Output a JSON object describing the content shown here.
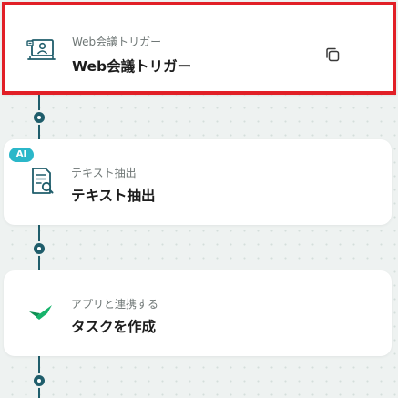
{
  "flow": {
    "steps": [
      {
        "subtitle": "Web会議トリガー",
        "title": "Web会議トリガー",
        "icon": "video-meeting-icon",
        "selected": true
      },
      {
        "subtitle": "テキスト抽出",
        "title": "テキスト抽出",
        "icon": "document-search-icon",
        "badge": "AI"
      },
      {
        "subtitle": "アプリと連携する",
        "title": "タスクを作成",
        "icon": "checkmark-app-icon"
      }
    ],
    "copy_icon": "copy-icon"
  },
  "colors": {
    "selection_border": "#e11f26",
    "connector": "#1f5d6b",
    "ai_badge": "#2bb7c9",
    "app_icon_green": "#16b36b",
    "canvas_background": "#eef2f1"
  }
}
